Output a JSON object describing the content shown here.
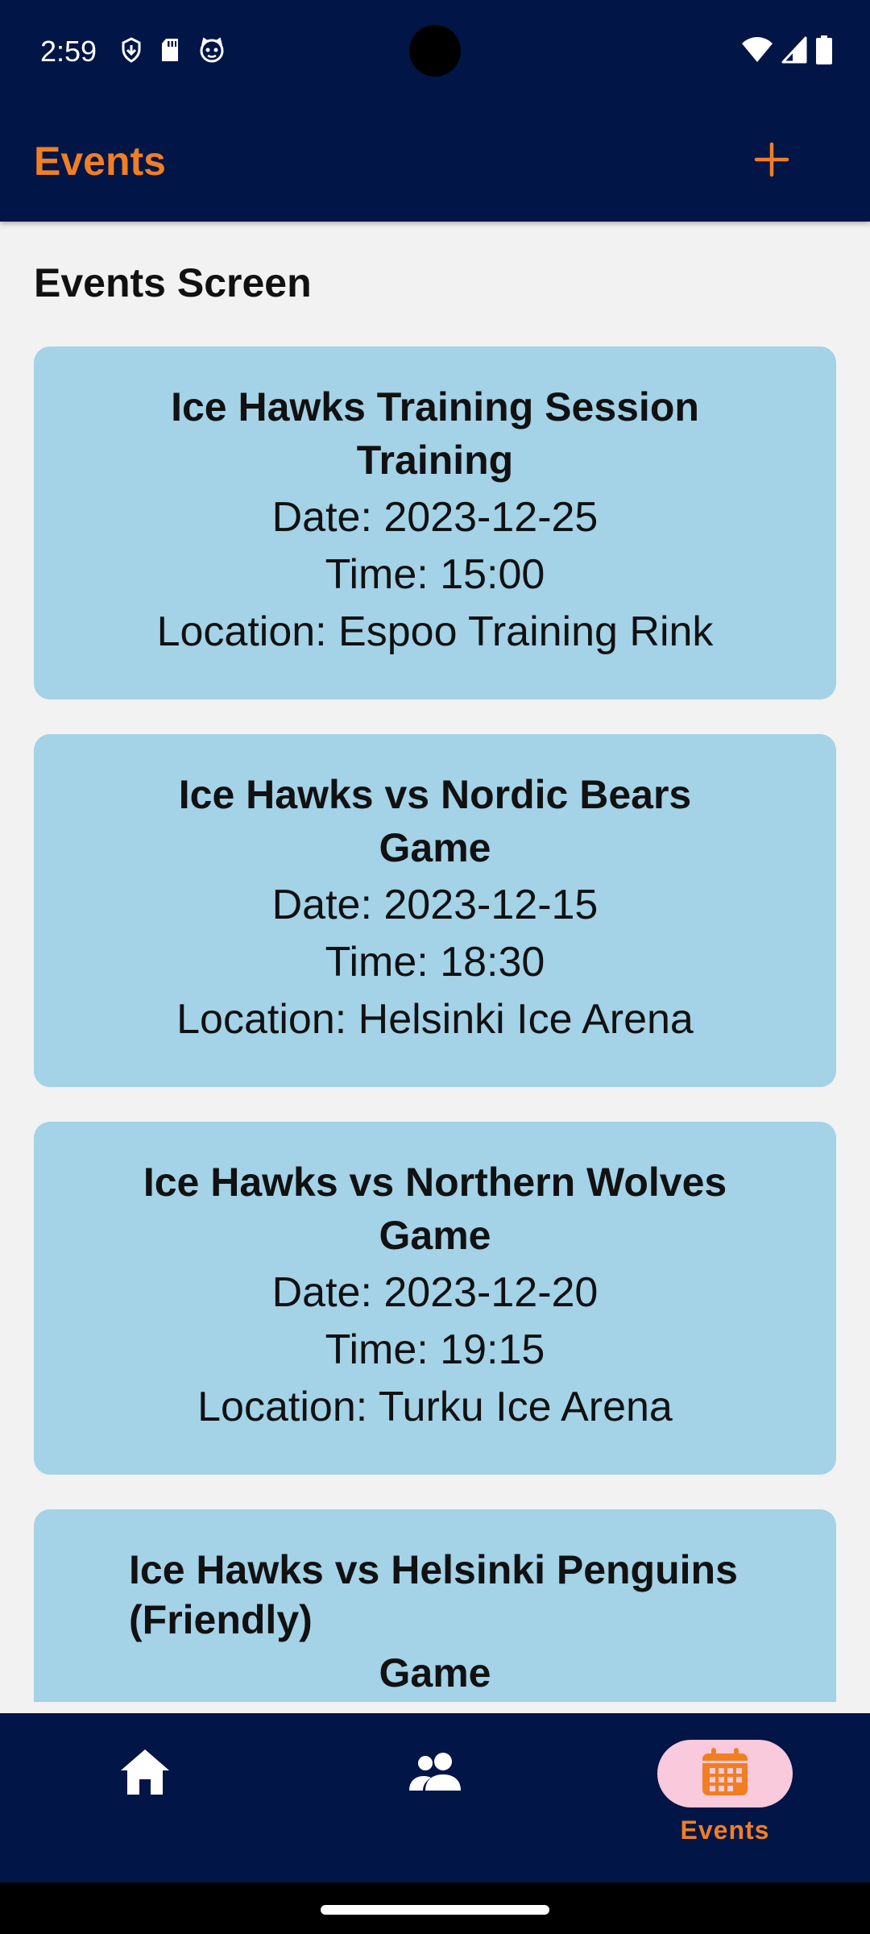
{
  "status_bar": {
    "time": "2:59",
    "left_icons": [
      "shield-download-icon",
      "sd-card-icon",
      "cat-face-icon"
    ],
    "right_icons": [
      "wifi-icon",
      "cellular-signal-icon",
      "battery-icon"
    ]
  },
  "app_bar": {
    "title": "Events",
    "action_icon": "plus-icon",
    "accent_color": "#f07f23",
    "background_color": "#021547"
  },
  "content": {
    "heading": "Events Screen",
    "events": [
      {
        "title": "Ice Hawks Training Session",
        "type": "Training",
        "date": "Date: 2023-12-25",
        "time": "Time: 15:00",
        "location": "Location: Espoo Training Rink"
      },
      {
        "title": "Ice Hawks vs Nordic Bears",
        "type": "Game",
        "date": "Date: 2023-12-15",
        "time": "Time: 18:30",
        "location": "Location: Helsinki Ice Arena"
      },
      {
        "title": "Ice Hawks vs Northern Wolves",
        "type": "Game",
        "date": "Date: 2023-12-20",
        "time": "Time: 19:15",
        "location": "Location: Turku Ice Arena"
      },
      {
        "title": "Ice Hawks vs Helsinki Penguins (Friendly)",
        "type": "Game"
      }
    ],
    "card_color": "#a4d2e7"
  },
  "bottom_nav": {
    "items": [
      {
        "icon": "home-icon",
        "label": ""
      },
      {
        "icon": "people-icon",
        "label": ""
      },
      {
        "icon": "calendar-icon",
        "label": "Events",
        "selected": true
      }
    ],
    "indicator_color": "#f9c9dc"
  }
}
